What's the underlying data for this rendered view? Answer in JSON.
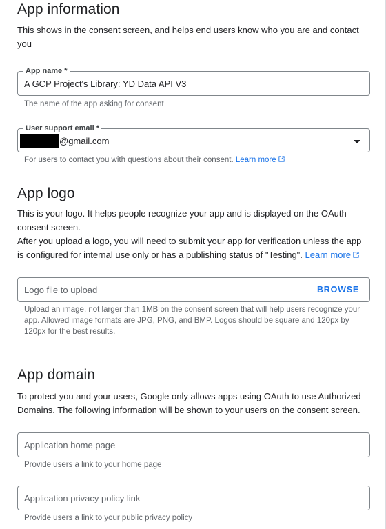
{
  "app_information": {
    "title": "App information",
    "description": "This shows in the consent screen, and helps end users know who you are and contact you",
    "app_name": {
      "label": "App name *",
      "value": "A GCP Project's Library: YD Data API V3",
      "hint": "The name of the app asking for consent"
    },
    "support_email": {
      "label": "User support email *",
      "value_suffix": "@gmail.com",
      "hint": "For users to contact you with questions about their consent.",
      "learn_more": "Learn more"
    }
  },
  "app_logo": {
    "title": "App logo",
    "description_1": "This is your logo. It helps people recognize your app and is displayed on the OAuth consent screen.",
    "description_2": "After you upload a logo, you will need to submit your app for verification unless the app is configured for internal use only or has a publishing status of \"Testing\".",
    "learn_more": "Learn more",
    "upload_placeholder": "Logo file to upload",
    "browse_label": "BROWSE",
    "hint": "Upload an image, not larger than 1MB on the consent screen that will help users recognize your app. Allowed image formats are JPG, PNG, and BMP. Logos should be square and 120px by 120px for the best results."
  },
  "app_domain": {
    "title": "App domain",
    "description": "To protect you and your users, Google only allows apps using OAuth to use Authorized Domains. The following information will be shown to your users on the consent screen.",
    "home_page": {
      "placeholder": "Application home page",
      "hint": "Provide users a link to your home page"
    },
    "privacy_policy": {
      "placeholder": "Application privacy policy link",
      "hint": "Provide users a link to your public privacy policy"
    }
  },
  "colors": {
    "link": "#1a73e8",
    "border": "#80868b",
    "hint_text": "#5f6368"
  }
}
